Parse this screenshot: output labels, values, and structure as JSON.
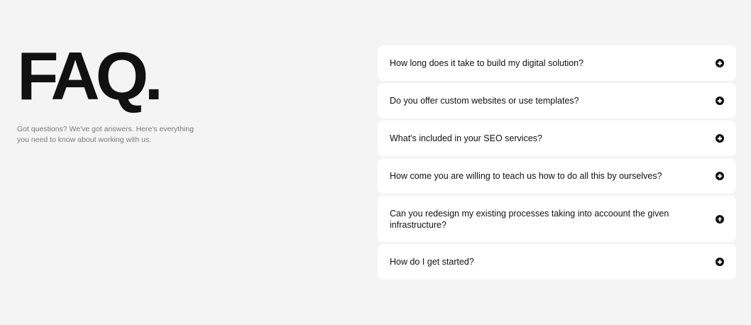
{
  "hero": {
    "title": "FAQ.",
    "subtitle": "Got questions? We've got answers. Here's everything you need to know about working with us."
  },
  "faq": {
    "items": [
      {
        "question": "How long does it take to build my digital solution?",
        "icon": "plus-circle-icon"
      },
      {
        "question": "Do you offer custom websites or use templates?",
        "icon": "plus-circle-icon"
      },
      {
        "question": "What's included in your SEO services?",
        "icon": "plus-circle-icon"
      },
      {
        "question": "How come you are willing to teach us how to do all this by ourselves?",
        "icon": "plus-circle-icon"
      },
      {
        "question": "Can you redesign my existing processes taking into accoount the given infrastructure?",
        "icon": "plus-circle-icon"
      },
      {
        "question": "How do I get started?",
        "icon": "plus-circle-icon"
      }
    ]
  },
  "colors": {
    "background": "#f4f4f4",
    "card": "#ffffff",
    "text": "#111111",
    "muted": "#7a7a7a"
  }
}
